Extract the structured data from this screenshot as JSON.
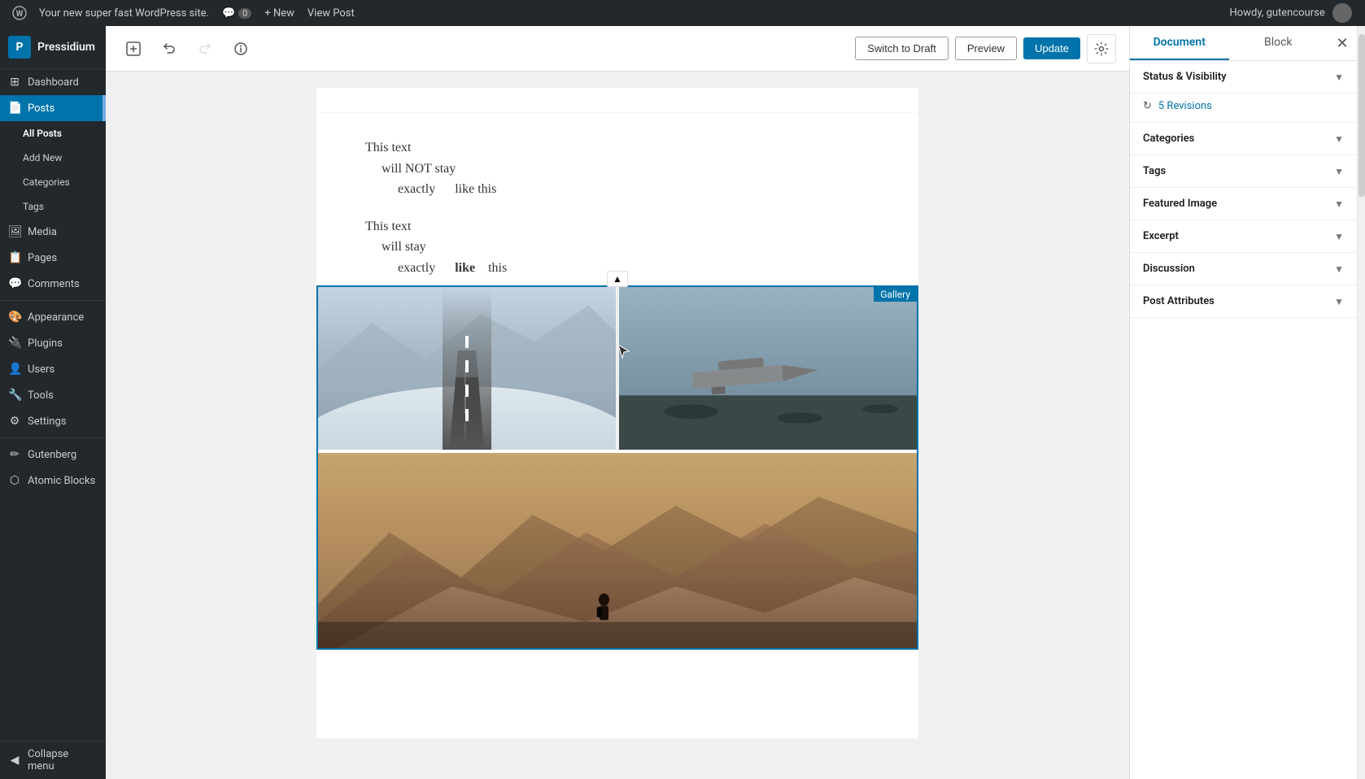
{
  "adminbar": {
    "logo": "W",
    "site_name": "Your new super fast WordPress site.",
    "comments_label": "Comments",
    "comments_count": "0",
    "new_label": "+ New",
    "view_post_label": "View Post",
    "howdy": "Howdy, gutencourse"
  },
  "sidebar": {
    "brand": "Pressidium",
    "items": [
      {
        "id": "dashboard",
        "label": "Dashboard",
        "icon": "⊞"
      },
      {
        "id": "posts",
        "label": "Posts",
        "icon": "📄",
        "active": true
      },
      {
        "id": "all-posts",
        "label": "All Posts",
        "sub": true
      },
      {
        "id": "add-new",
        "label": "Add New",
        "sub": true
      },
      {
        "id": "categories",
        "label": "Categories",
        "sub": true
      },
      {
        "id": "tags",
        "label": "Tags",
        "sub": true
      },
      {
        "id": "media",
        "label": "Media",
        "icon": "🖼"
      },
      {
        "id": "pages",
        "label": "Pages",
        "icon": "📋"
      },
      {
        "id": "comments",
        "label": "Comments",
        "icon": "💬"
      },
      {
        "id": "appearance",
        "label": "Appearance",
        "icon": "🎨"
      },
      {
        "id": "plugins",
        "label": "Plugins",
        "icon": "🔌"
      },
      {
        "id": "users",
        "label": "Users",
        "icon": "👤"
      },
      {
        "id": "tools",
        "label": "Tools",
        "icon": "🔧"
      },
      {
        "id": "settings",
        "label": "Settings",
        "icon": "⚙"
      },
      {
        "id": "gutenberg",
        "label": "Gutenberg",
        "icon": "✏"
      },
      {
        "id": "atomic-blocks",
        "label": "Atomic Blocks",
        "icon": "⬡"
      },
      {
        "id": "collapse-menu",
        "label": "Collapse menu",
        "icon": "◀"
      }
    ]
  },
  "toolbar": {
    "add_block_label": "+",
    "undo_label": "↩",
    "redo_label": "↪",
    "info_label": "ℹ",
    "switch_draft_label": "Switch to Draft",
    "preview_label": "Preview",
    "publish_label": "Update",
    "settings_label": "⚙"
  },
  "editor": {
    "text_block_1": {
      "line1": "This text",
      "line2": "will NOT stay",
      "line3": "exactly",
      "line4": "like this"
    },
    "text_block_2": {
      "line1": "This text",
      "line2": "will stay",
      "line3": "exactly",
      "line4": "like",
      "line5": "this"
    },
    "gallery_label": "Gallery"
  },
  "right_panel": {
    "tab_document": "Document",
    "tab_block": "Block",
    "close_label": "✕",
    "sections": [
      {
        "id": "status-visibility",
        "label": "Status & Visibility",
        "expanded": false
      },
      {
        "id": "revisions",
        "label": "5 Revisions",
        "type": "revisions"
      },
      {
        "id": "categories",
        "label": "Categories",
        "expanded": false
      },
      {
        "id": "tags",
        "label": "Tags",
        "expanded": false
      },
      {
        "id": "featured-image",
        "label": "Featured Image",
        "expanded": false
      },
      {
        "id": "excerpt",
        "label": "Excerpt",
        "expanded": false
      },
      {
        "id": "discussion",
        "label": "Discussion",
        "expanded": false
      },
      {
        "id": "post-attributes",
        "label": "Post Attributes",
        "expanded": false
      }
    ],
    "colors": {
      "accent": "#0073aa",
      "active_tab_border": "#0073aa"
    }
  }
}
